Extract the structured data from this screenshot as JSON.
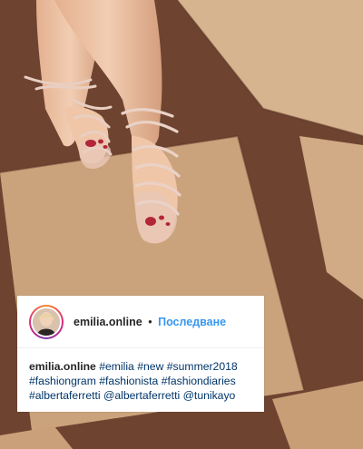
{
  "post": {
    "username": "emilia.online",
    "separator": "•",
    "follow_label": "Последване"
  },
  "caption": {
    "username": "emilia.online",
    "tags": [
      "#emilia",
      "#new",
      "#summer2018",
      "#fashiongram",
      "#fashionista",
      "#fashiondiaries",
      "#albertaferretti",
      "@albertaferretti",
      "@tunikayo"
    ]
  },
  "colors": {
    "link_blue": "#3897f0",
    "hashtag": "#003569",
    "text": "#262626"
  }
}
